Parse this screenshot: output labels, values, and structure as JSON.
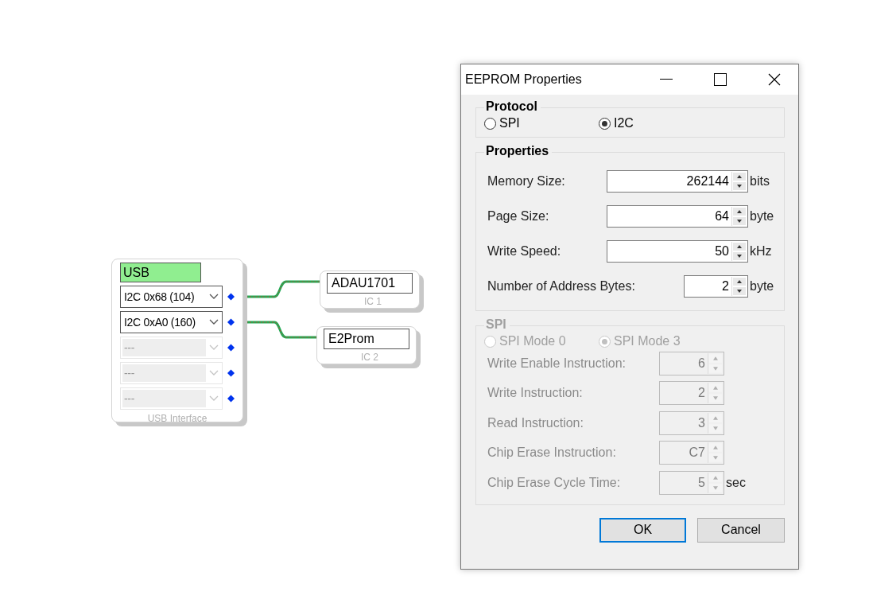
{
  "canvas": {
    "usb_block": {
      "name": "USB",
      "caption": "USB Interface",
      "ports": [
        {
          "value": "I2C 0x68 (104)",
          "disabled": false,
          "connected": true
        },
        {
          "value": "I2C 0xA0 (160)",
          "disabled": false,
          "connected": true
        },
        {
          "value": "---",
          "disabled": true,
          "connected": false
        },
        {
          "value": "---",
          "disabled": true,
          "connected": false
        },
        {
          "value": "---",
          "disabled": true,
          "connected": false
        }
      ]
    },
    "ic_blocks": [
      {
        "name": "ADAU1701",
        "caption": "IC 1"
      },
      {
        "name": "E2Prom",
        "caption": "IC 2"
      }
    ]
  },
  "dialog": {
    "title": "EEPROM Properties",
    "protocol": {
      "title": "Protocol",
      "options": [
        {
          "label": "SPI",
          "selected": false
        },
        {
          "label": "I2C",
          "selected": true
        }
      ]
    },
    "properties": {
      "title": "Properties",
      "fields": [
        {
          "label": "Memory Size:",
          "value": "262144",
          "unit": "bits",
          "kind": "wide"
        },
        {
          "label": "Page Size:",
          "value": "64",
          "unit": "byte",
          "kind": "wide"
        },
        {
          "label": "Write Speed:",
          "value": "50",
          "unit": "kHz",
          "kind": "wide"
        },
        {
          "label": "Number of Address Bytes:",
          "value": "2",
          "unit": "byte",
          "kind": "short"
        }
      ]
    },
    "spi": {
      "title": "SPI",
      "disabled": true,
      "modes": [
        {
          "label": "SPI Mode 0",
          "selected": false
        },
        {
          "label": "SPI Mode 3",
          "selected": true
        }
      ],
      "fields": [
        {
          "label": "Write Enable Instruction:",
          "value": "6"
        },
        {
          "label": "Write Instruction:",
          "value": "2"
        },
        {
          "label": "Read Instruction:",
          "value": "3"
        },
        {
          "label": "Chip Erase Instruction:",
          "value": "C7"
        },
        {
          "label": "Chip Erase Cycle Time:",
          "value": "5",
          "unit": "sec"
        }
      ]
    },
    "buttons": [
      {
        "label": "OK",
        "default": true
      },
      {
        "label": "Cancel",
        "default": false
      }
    ]
  }
}
